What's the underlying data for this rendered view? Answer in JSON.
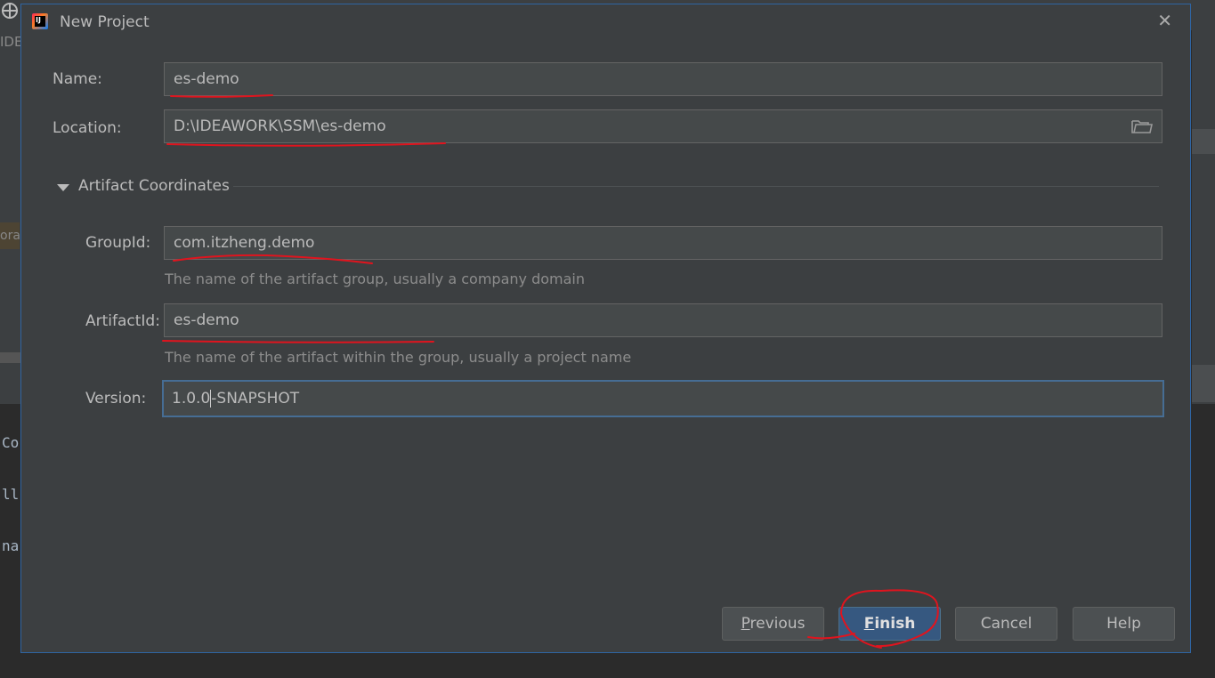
{
  "background": {
    "code_lines": [
      "Co",
      "ll",
      "na"
    ],
    "ide_text": "IDE",
    "orange_text": "ora"
  },
  "dialog": {
    "title": "New Project",
    "close_label": "✕",
    "name": {
      "label": "Name:",
      "value": "es-demo"
    },
    "location": {
      "label": "Location:",
      "value": "D:\\IDEAWORK\\SSM\\es-demo"
    },
    "section": {
      "title": "Artifact Coordinates"
    },
    "group_id": {
      "label": "GroupId:",
      "value": "com.itzheng.demo",
      "hint": "The name of the artifact group, usually a company domain"
    },
    "artifact_id": {
      "label": "ArtifactId:",
      "value": "es-demo",
      "hint": "The name of the artifact within the group, usually a project name"
    },
    "version": {
      "label": "Version:",
      "value_before_caret": "1.0.0",
      "value_after_caret": "-SNAPSHOT"
    },
    "buttons": {
      "previous_mnemonic": "P",
      "previous_rest": "revious",
      "finish_mnemonic": "F",
      "finish_rest": "inish",
      "cancel": "Cancel",
      "help": "Help"
    }
  },
  "colors": {
    "dialog_bg": "#3c3f41",
    "field_bg": "#45494a",
    "focus_border": "#466d94",
    "primary_button": "#365880",
    "annotation_red": "#e0141e"
  },
  "icons": [
    "intellij-logo-icon",
    "close-icon",
    "folder-icon",
    "triangle-down-icon",
    "target-icon"
  ]
}
